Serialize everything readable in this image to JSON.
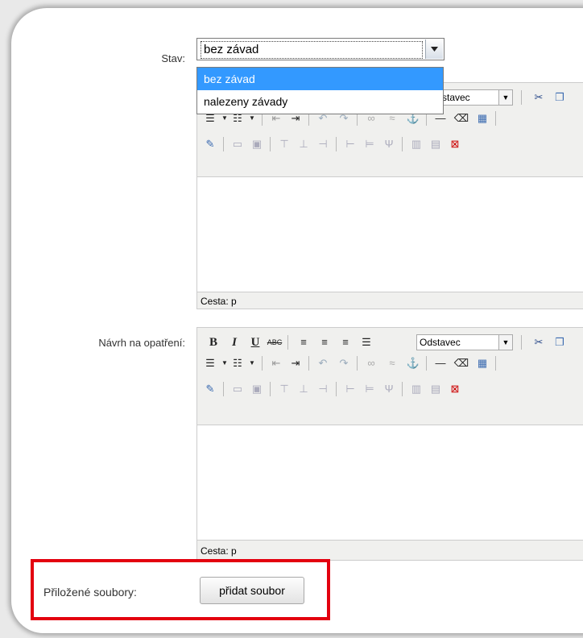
{
  "form": {
    "stav_label": "Stav:",
    "stav_value": "bez závad",
    "stav_options": [
      "bez závad",
      "nalezeny závady"
    ],
    "navrh_label": "Návrh na opatření:",
    "prilohy_label": "Přiložené soubory:",
    "add_file_label": "přidat soubor"
  },
  "editor1": {
    "format_value": "stavec",
    "path_label": "Cesta: p"
  },
  "editor2": {
    "bold": "B",
    "italic": "I",
    "underline": "U",
    "strike": "ABC",
    "format_value": "Odstavec",
    "path_label": "Cesta: p"
  },
  "colors": {
    "highlight": "#e3000f",
    "option_selected": "#3399ff"
  }
}
